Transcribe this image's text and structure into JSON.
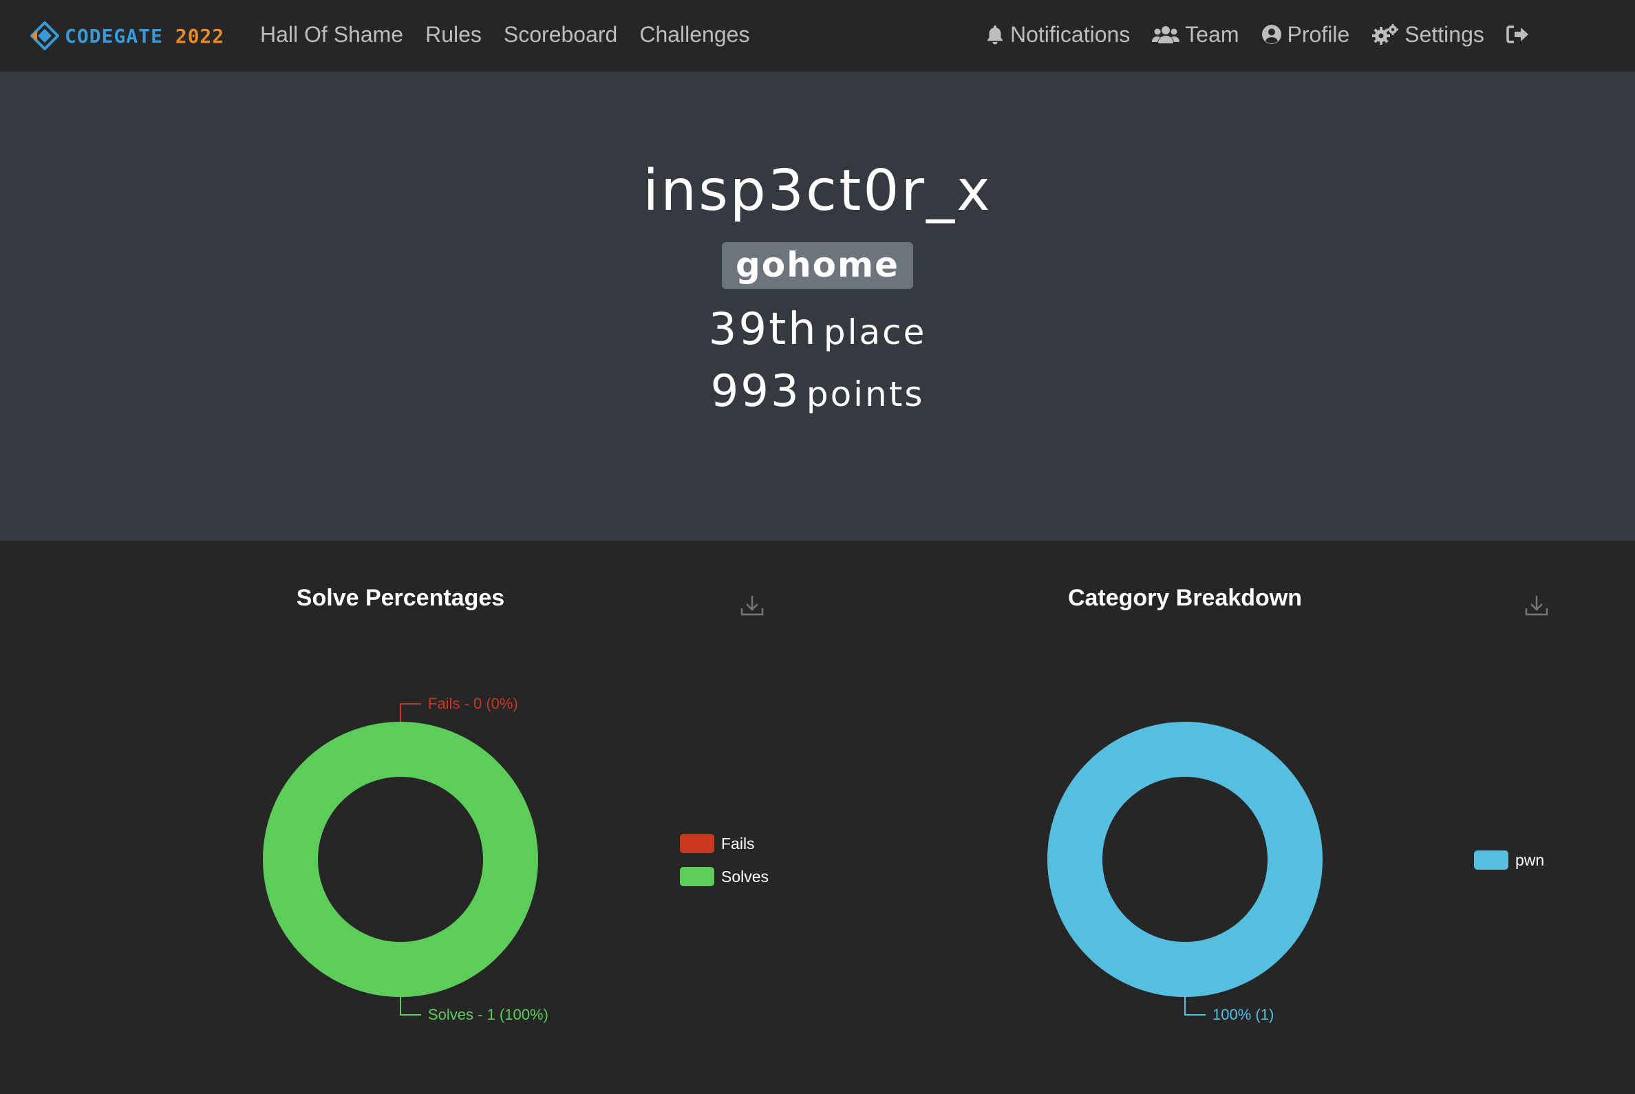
{
  "brand": {
    "part1": "CODEGATE",
    "part2": "2022"
  },
  "nav": {
    "left": [
      {
        "label": "Hall Of Shame"
      },
      {
        "label": "Rules"
      },
      {
        "label": "Scoreboard"
      },
      {
        "label": "Challenges"
      }
    ],
    "right": [
      {
        "label": "Notifications",
        "icon": "bell-icon"
      },
      {
        "label": "Team",
        "icon": "users-icon"
      },
      {
        "label": "Profile",
        "icon": "user-circle-icon"
      },
      {
        "label": "Settings",
        "icon": "gears-icon"
      },
      {
        "label": "",
        "icon": "logout-icon"
      }
    ]
  },
  "profile": {
    "username": "insp3ct0r_x",
    "team": "gohome",
    "place_number": "39th",
    "place_label": "place",
    "points_number": "993",
    "points_label": "points"
  },
  "colors": {
    "fails": "#c9381f",
    "solves": "#5ccd59",
    "category": "#56bee0"
  },
  "chart_data": [
    {
      "type": "pie",
      "title": "Solve Percentages",
      "categories": [
        "Fails",
        "Solves"
      ],
      "values": [
        0,
        1
      ],
      "labels": [
        "Fails - 0 (0%)",
        "Solves - 1 (100%)"
      ],
      "legend": "right"
    },
    {
      "type": "pie",
      "title": "Category Breakdown",
      "categories": [
        "pwn"
      ],
      "values": [
        1
      ],
      "labels": [
        "100% (1)"
      ],
      "legend": "right"
    }
  ]
}
